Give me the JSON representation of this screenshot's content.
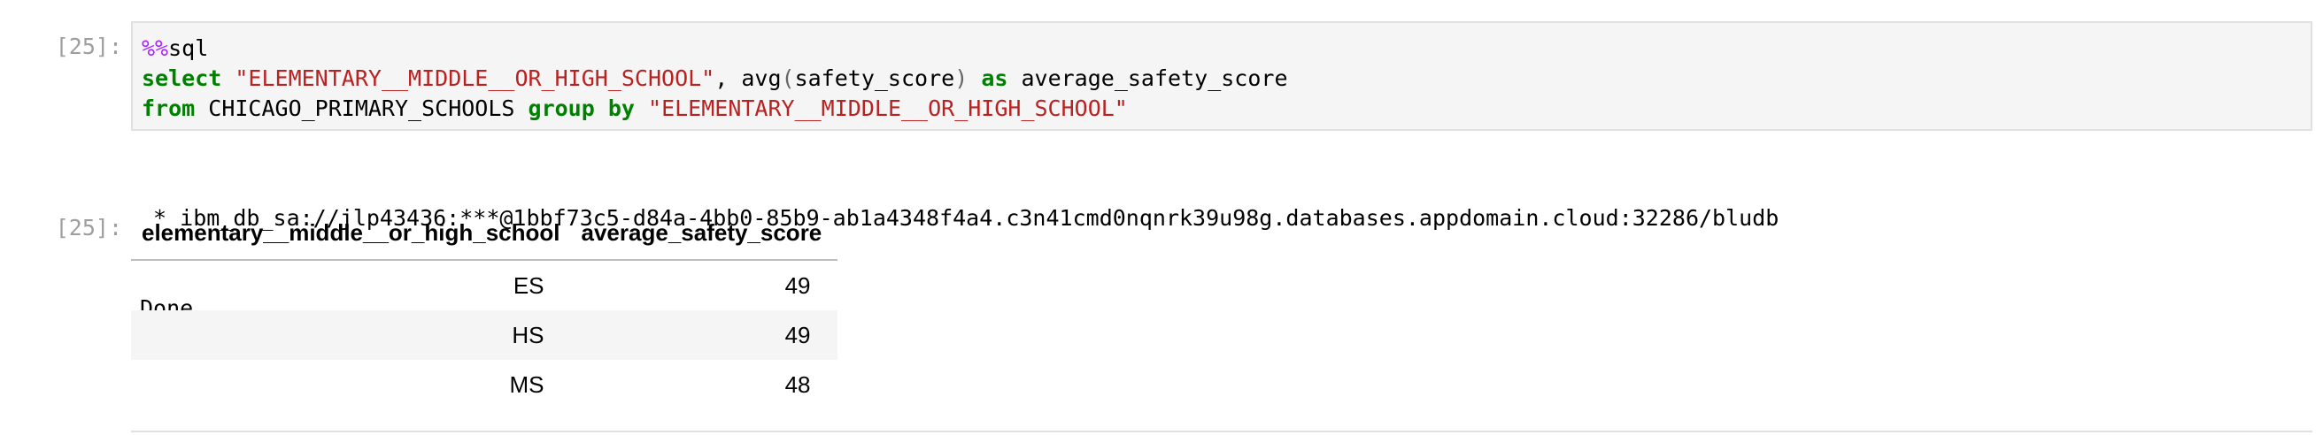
{
  "cell": {
    "input_prompt": "[25]:",
    "output_prompt": "[25]:",
    "code": {
      "line1": {
        "magic": "%%",
        "rest": "sql"
      },
      "line2": {
        "kw_select": "select",
        "sp1": " ",
        "col_str": "\"ELEMENTARY__MIDDLE__OR_HIGH_SCHOOL\"",
        "comma": ", ",
        "fn": "avg",
        "paren_open": "(",
        "arg": "safety_score",
        "paren_close": ")",
        "sp2": " ",
        "kw_as": "as",
        "alias": " average_safety_score"
      },
      "line3": {
        "kw_from": "from",
        "table": " CHICAGO_PRIMARY_SCHOOLS ",
        "kw_group": "group",
        "sp": " ",
        "kw_by": "by",
        "sp2": " ",
        "group_str": "\"ELEMENTARY__MIDDLE__OR_HIGH_SCHOOL\""
      }
    },
    "stream_output": {
      "connection_line": " * ibm_db_sa://jlp43436:***@1bbf73c5-d84a-4bb0-85b9-ab1a4348f4a4.c3n41cmd0nqnrk39u98g.databases.appdomain.cloud:32286/bludb",
      "status_line": "Done."
    },
    "result_table": {
      "columns": [
        "elementary__middle__or_high_school",
        "average_safety_score"
      ],
      "rows": [
        [
          "ES",
          "49"
        ],
        [
          "HS",
          "49"
        ],
        [
          "MS",
          "48"
        ]
      ]
    }
  },
  "colors": {
    "keyword": "#008000",
    "string": "#ba2121",
    "magic": "#aa22ff",
    "prompt": "#9e9e9e",
    "cell_background": "#f5f5f5",
    "cell_border": "#e0e0e0"
  }
}
